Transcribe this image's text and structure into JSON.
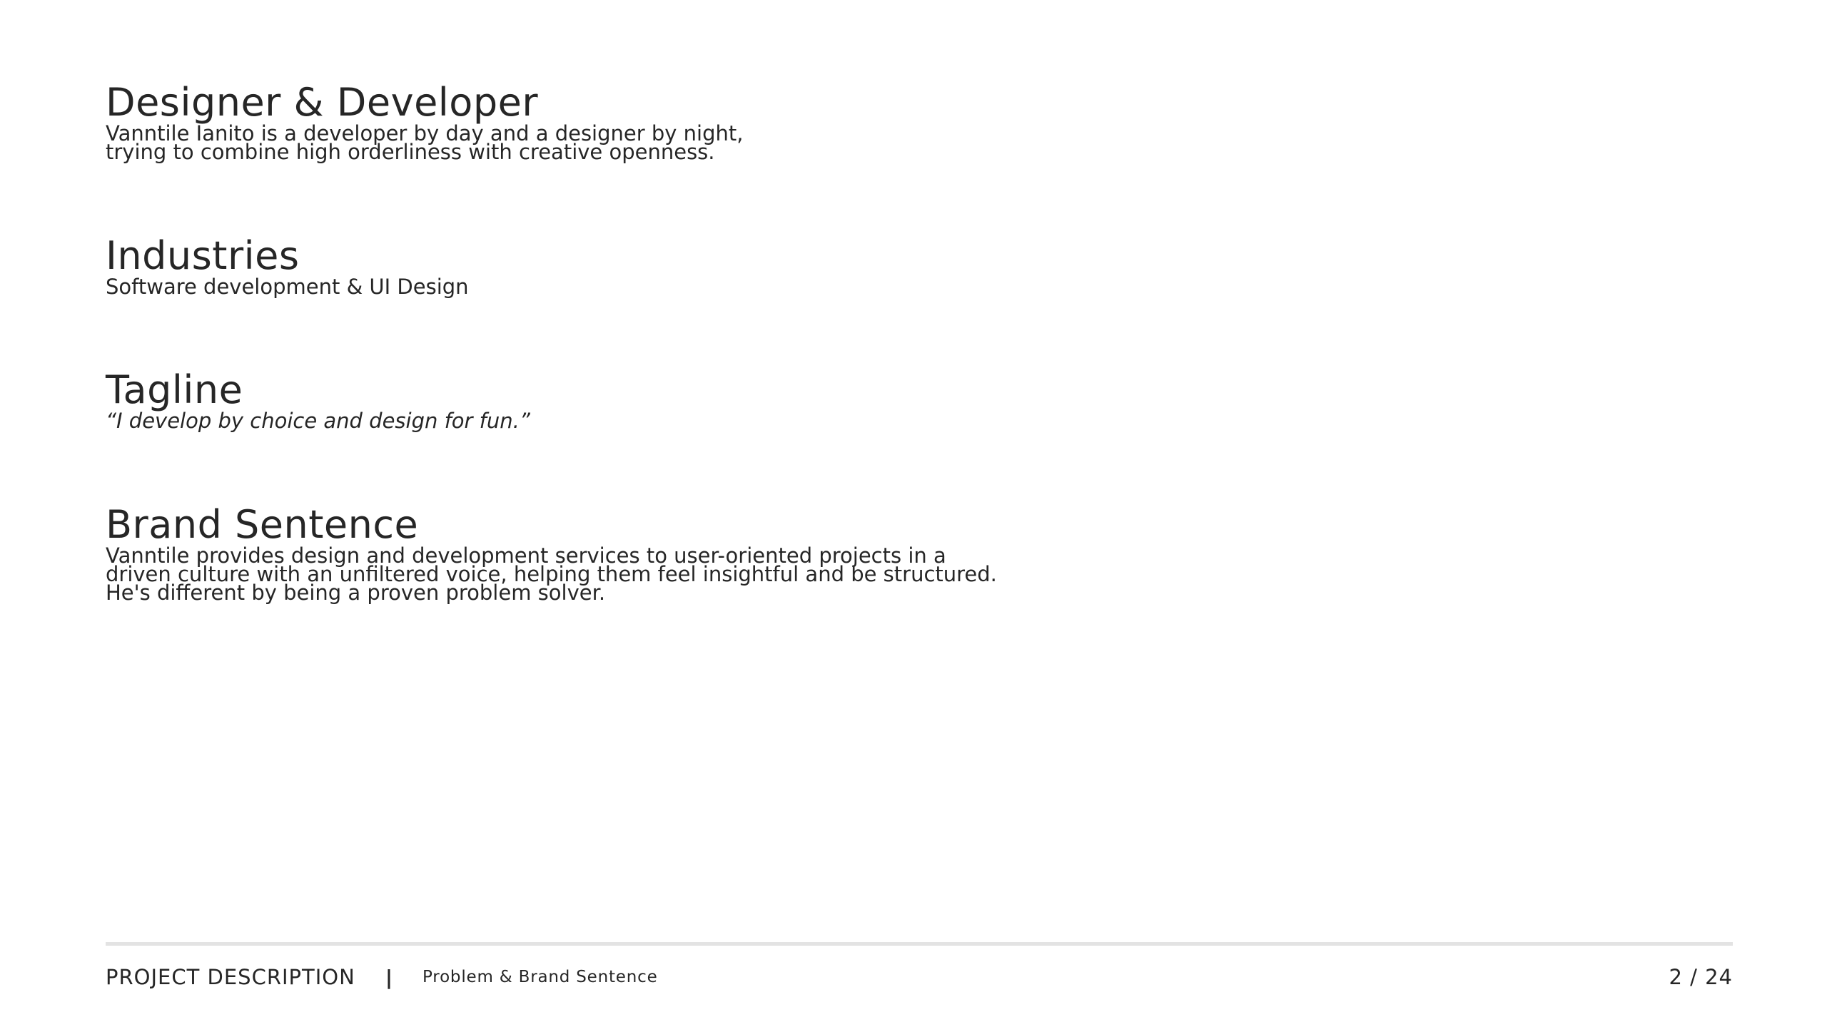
{
  "sections": {
    "designer": {
      "heading": "Designer & Developer",
      "lines": [
        "Vanntile Ianito is a developer by day and a designer by night,",
        "trying to combine high orderliness with creative openness."
      ]
    },
    "industries": {
      "heading": "Industries",
      "lines": [
        "Software development & UI Design"
      ]
    },
    "tagline": {
      "heading": "Tagline",
      "lines": [
        "“I develop by choice and design for fun.”"
      ]
    },
    "brand": {
      "heading": "Brand Sentence",
      "lines": [
        "Vanntile provides design and development services to user-oriented projects in a",
        "driven culture with an unfiltered voice, helping them feel insightful and be structured.",
        "He's different by being a proven problem solver."
      ]
    }
  },
  "footer": {
    "title": "PROJECT DESCRIPTION",
    "separator": "|",
    "subtitle": "Problem & Brand Sentence",
    "page": "2 / 24"
  }
}
